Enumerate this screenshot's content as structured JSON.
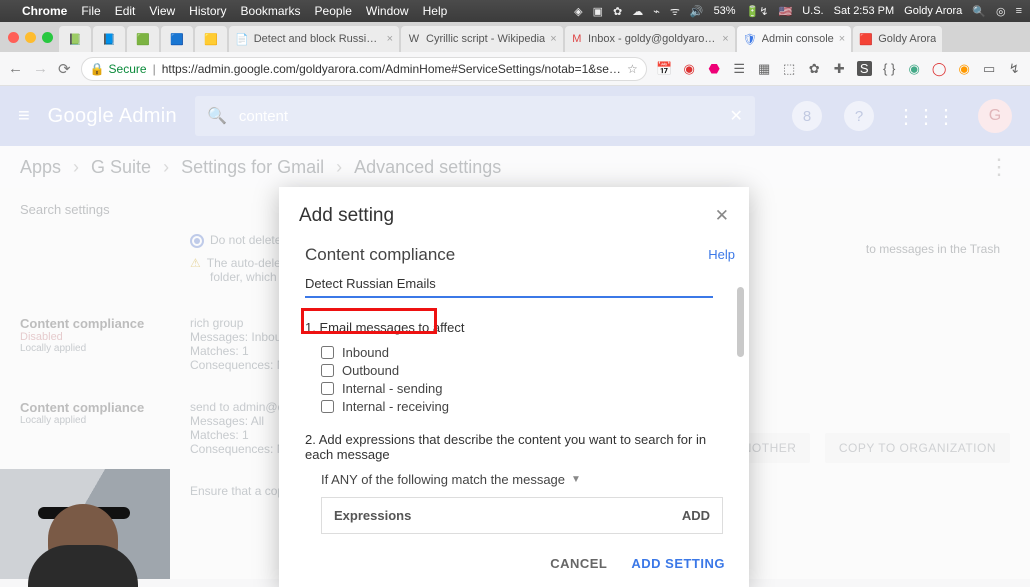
{
  "mac_menu": {
    "app": "Chrome",
    "items": [
      "File",
      "Edit",
      "View",
      "History",
      "Bookmarks",
      "People",
      "Window",
      "Help"
    ],
    "battery": "53%",
    "locale": "U.S.",
    "clock": "Sat 2:53 PM",
    "user": "Goldy Arora"
  },
  "tabs": {
    "items": [
      {
        "icon": "📗",
        "title": ""
      },
      {
        "icon": "📘",
        "title": ""
      },
      {
        "icon": "🟩",
        "title": ""
      },
      {
        "icon": "🟦",
        "title": ""
      },
      {
        "icon": "🟨",
        "title": ""
      },
      {
        "icon": "📄",
        "title": "Detect and block Russian la…"
      },
      {
        "icon": "W",
        "title": "Cyrillic script - Wikipedia"
      },
      {
        "icon": "M",
        "title": "Inbox - goldy@goldyarora.c…"
      },
      {
        "icon": "🛡",
        "title": "Admin console",
        "active": true
      },
      {
        "icon": "🟥",
        "title": "Goldy Arora"
      }
    ]
  },
  "omnibox": {
    "secure_label": "Secure",
    "url": "https://admin.google.com/goldyarora.com/AdminHome#ServiceSettings/notab=1&se…"
  },
  "admin_bar": {
    "brand_a": "Google",
    "brand_b": "Admin",
    "search_value": "content",
    "avatar": "G"
  },
  "breadcrumbs": [
    "Apps",
    "G Suite",
    "Settings for Gmail",
    "Advanced settings"
  ],
  "bg": {
    "search_settings": "Search settings",
    "radio_label": "Do not delete em",
    "autodel": "The auto-deletion",
    "autodel2": "folder, which are e",
    "autodel_tail": "to messages in the Trash",
    "cc_heading": "Content compliance",
    "disabled": "Disabled",
    "locally": "Locally applied",
    "rich_group": "rich group",
    "messages_inbound": "Messages:  Inbound",
    "matches1": "Matches:  1",
    "consequences": "Consequences:  Mod",
    "send_to": "send to admin@dem",
    "messages_all": "Messages:  All",
    "ensure": "Ensure that a cop",
    "btn_another": "ANOTHER",
    "btn_copy": "COPY TO ORGANIZATION"
  },
  "modal": {
    "title": "Add setting",
    "section": "Content compliance",
    "help": "Help",
    "name_value": "Detect Russian Emails",
    "s1": "1. Email messages to affect",
    "chk": [
      "Inbound",
      "Outbound",
      "Internal - sending",
      "Internal - receiving"
    ],
    "s2": "2. Add expressions that describe the content you want to search for in each message",
    "dropdown": "If ANY of the following match the message",
    "expr_head": "Expressions",
    "expr_add": "ADD",
    "cancel": "CANCEL",
    "primary": "ADD SETTING"
  }
}
